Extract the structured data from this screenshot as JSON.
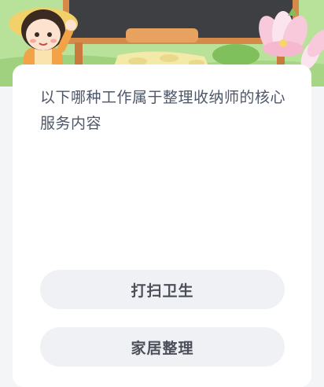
{
  "banner": {
    "character": "cartoon-girl-with-straw-hat",
    "decoration": "lotus-flowers",
    "board": "chalkboard"
  },
  "quiz": {
    "question": "以下哪种工作属于整理收纳师的核心服务内容",
    "options": [
      {
        "label": "打扫卫生"
      },
      {
        "label": "家居整理"
      }
    ]
  },
  "colors": {
    "page_background": "#f4f5f7",
    "card_background": "#ffffff",
    "option_background": "#f0f1f4",
    "question_text": "#4e5767",
    "option_text": "#4a4f5a"
  }
}
